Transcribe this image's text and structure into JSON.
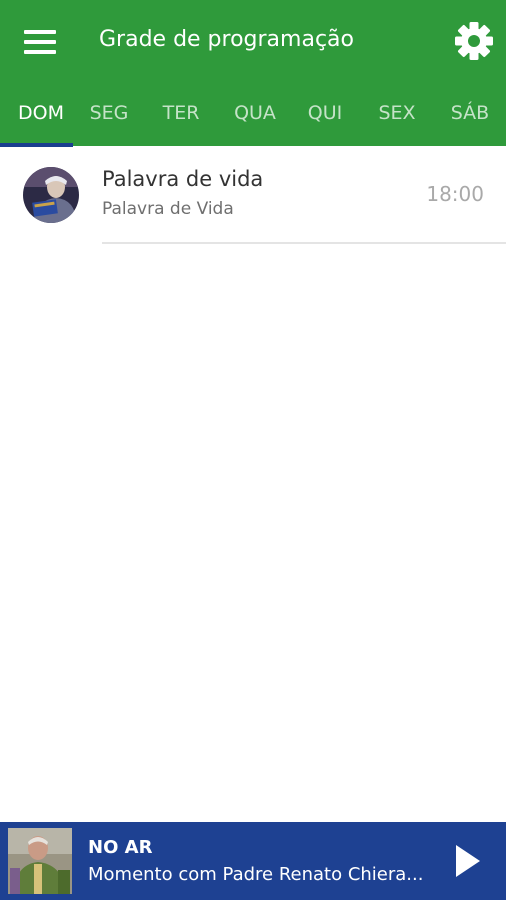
{
  "header": {
    "title": "Grade de programação",
    "menu_icon": "menu-icon",
    "settings_icon": "gear-icon",
    "background_color": "#2f9a3b"
  },
  "tabs": [
    {
      "label": "DOM",
      "active": true
    },
    {
      "label": "SEG",
      "active": false
    },
    {
      "label": "TER",
      "active": false
    },
    {
      "label": "QUA",
      "active": false
    },
    {
      "label": "QUI",
      "active": false
    },
    {
      "label": "SEX",
      "active": false
    },
    {
      "label": "SÁB",
      "active": false
    }
  ],
  "schedule": [
    {
      "title": "Palavra de vida",
      "subtitle": "Palavra de Vida",
      "time": "18:00"
    }
  ],
  "player": {
    "status": "NO AR",
    "program": "Momento com Padre Renato Chiera...",
    "play_icon": "play-icon",
    "background_color": "#1e4192"
  }
}
